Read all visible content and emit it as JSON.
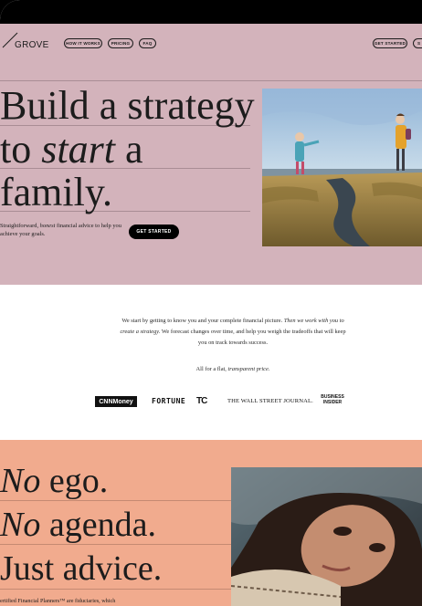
{
  "nav": {
    "logo_text": "GROVE",
    "links": [
      "HOW IT WORKS",
      "PRICING",
      "FAQ"
    ],
    "cta": "GET STARTED",
    "cta2": "S"
  },
  "hero": {
    "line1": "Build a strategy",
    "line2_pre": "to ",
    "line2_em": "start",
    "line2_post": " a",
    "line3": "family.",
    "sub_pre": "Straightforward, ",
    "sub_em": "honest",
    "sub_post": " financial advice to help you achieve your goals.",
    "cta": "GET STARTED"
  },
  "intro": {
    "p1_a": "We start by getting to know you and your complete financial picture. ",
    "p1_em": "Then we work with you to create a strategy.",
    "p1_b": " We forecast changes over time, and help you weigh the tradeoffs that will keep you on track towards success.",
    "p2_a": "All for a flat, ",
    "p2_em": "transparent price."
  },
  "press": [
    "CNNMoney",
    "FORTUNE",
    "TC",
    "THE WALL STREET JOURNAL.",
    "BUSINESS",
    "INSIDER"
  ],
  "section2": {
    "line1_em": "No",
    "line1_post": " ego.",
    "line2_em": "No",
    "line2_post": " agenda.",
    "line3": "Just advice.",
    "fine": "ertified Financial Planners™ are fiduciaries, which"
  },
  "colors": {
    "hero_bg": "#d3b3bb",
    "section2_bg": "#f1ab8e",
    "cta_bg": "#000000"
  }
}
